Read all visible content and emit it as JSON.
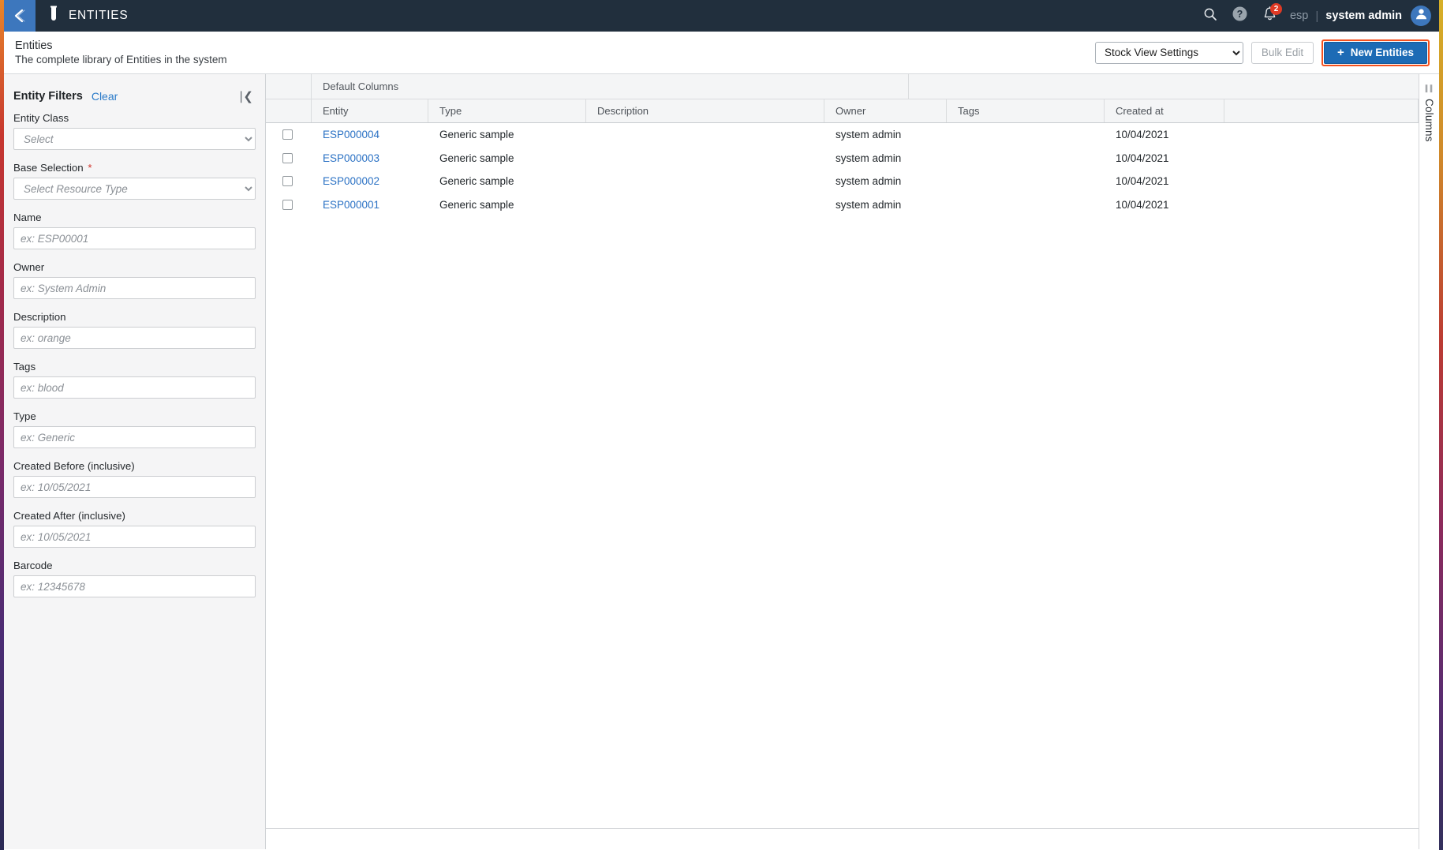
{
  "topbar": {
    "back_icon": "chevron-left-icon",
    "app_icon": "test-tube-icon",
    "title": "ENTITIES",
    "search_icon": "search-icon",
    "help_icon": "help-circle-icon",
    "notifications_icon": "bell-icon",
    "notifications_count": "2",
    "org": "esp",
    "separator": "|",
    "user": "system admin",
    "avatar_icon": "user-avatar-icon",
    "bg_color": "#212f3d",
    "accent_color": "#3d77bd"
  },
  "page_header": {
    "title": "Entities",
    "subtitle": "The complete library of Entities in the system",
    "view_settings_selected": "Stock View Settings",
    "view_settings_options": [
      "Stock View Settings"
    ],
    "bulk_edit_label": "Bulk Edit",
    "new_entities_label": "New Entities",
    "new_entities_plus": "+",
    "highlight_color": "#f4501e",
    "primary_button_color": "#1d6bb5"
  },
  "filters": {
    "title": "Entity Filters",
    "clear_label": "Clear",
    "collapse_icon": "collapse-left-icon",
    "fields": [
      {
        "label": "Entity Class",
        "type": "select",
        "placeholder": "Select",
        "required": false,
        "name": "entity-class"
      },
      {
        "label": "Base Selection",
        "type": "select",
        "placeholder": "Select Resource Type",
        "required": true,
        "name": "base-selection"
      },
      {
        "label": "Name",
        "type": "text",
        "placeholder": "ex: ESP00001",
        "required": false,
        "name": "name"
      },
      {
        "label": "Owner",
        "type": "text",
        "placeholder": "ex: System Admin",
        "required": false,
        "name": "owner"
      },
      {
        "label": "Description",
        "type": "text",
        "placeholder": "ex: orange",
        "required": false,
        "name": "description"
      },
      {
        "label": "Tags",
        "type": "text",
        "placeholder": "ex: blood",
        "required": false,
        "name": "tags"
      },
      {
        "label": "Type",
        "type": "text",
        "placeholder": "ex: Generic",
        "required": false,
        "name": "type"
      },
      {
        "label": "Created Before (inclusive)",
        "type": "text",
        "placeholder": "ex: 10/05/2021",
        "required": false,
        "name": "created-before"
      },
      {
        "label": "Created After (inclusive)",
        "type": "text",
        "placeholder": "ex: 10/05/2021",
        "required": false,
        "name": "created-after"
      },
      {
        "label": "Barcode",
        "type": "text",
        "placeholder": "ex: 12345678",
        "required": false,
        "name": "barcode"
      }
    ],
    "required_marker": "*"
  },
  "table": {
    "group_header": "Default Columns",
    "columns": [
      "Entity",
      "Type",
      "Description",
      "Owner",
      "Tags",
      "Created at"
    ],
    "rows": [
      {
        "entity": "ESP000004",
        "type": "Generic sample",
        "description": "",
        "owner": "system admin",
        "tags": "",
        "created_at": "10/04/2021"
      },
      {
        "entity": "ESP000003",
        "type": "Generic sample",
        "description": "",
        "owner": "system admin",
        "tags": "",
        "created_at": "10/04/2021"
      },
      {
        "entity": "ESP000002",
        "type": "Generic sample",
        "description": "",
        "owner": "system admin",
        "tags": "",
        "created_at": "10/04/2021"
      },
      {
        "entity": "ESP000001",
        "type": "Generic sample",
        "description": "",
        "owner": "system admin",
        "tags": "",
        "created_at": "10/04/2021"
      }
    ]
  },
  "columns_rail": {
    "label": "Columns",
    "grip_icon": "grip-lines-icon"
  }
}
